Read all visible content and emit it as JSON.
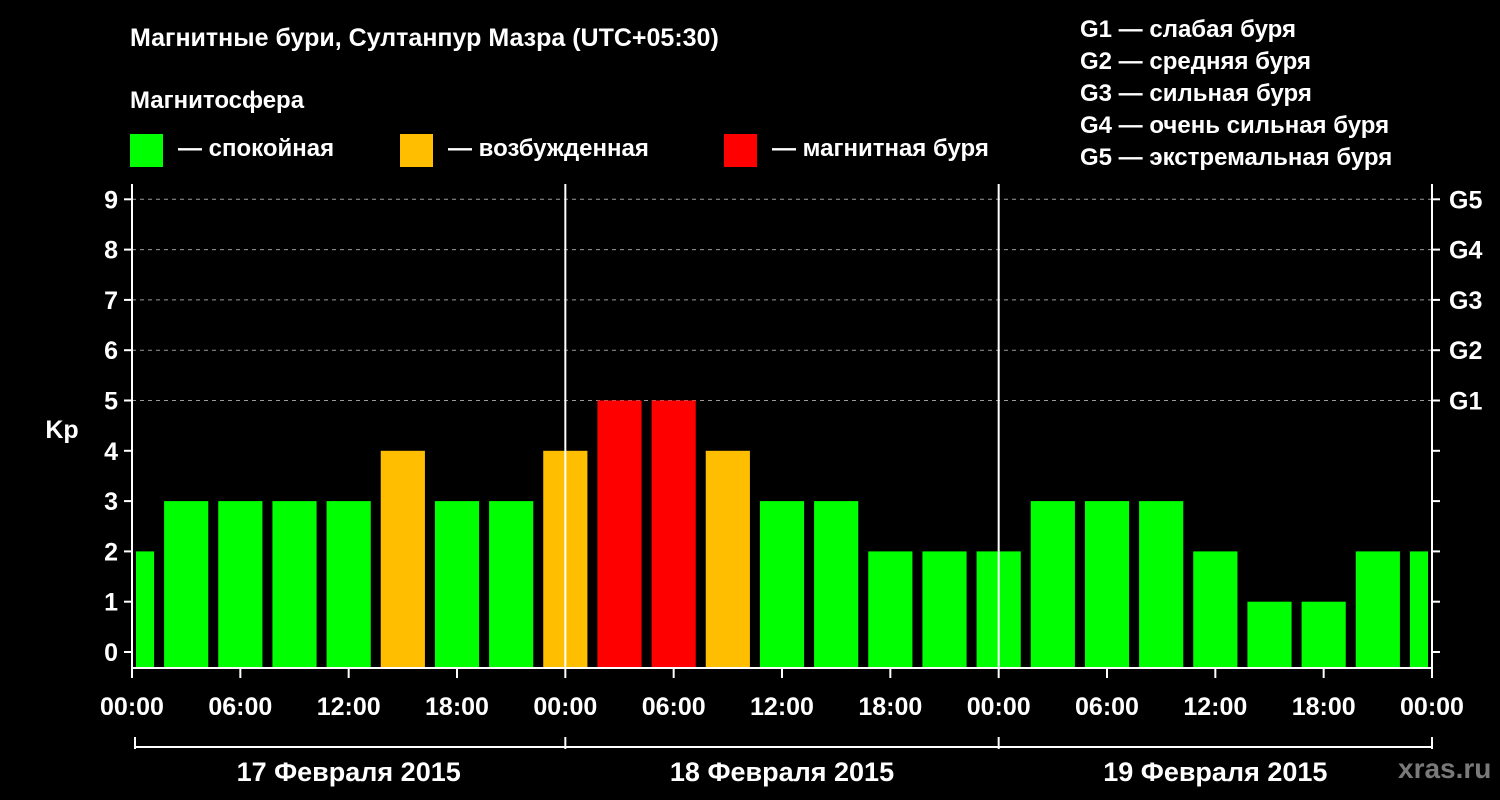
{
  "title": "Магнитные бури, Султанпур Мазра (UTC+05:30)",
  "magnetosphere_title": "Магнитосфера",
  "legend": [
    {
      "label": "— спокойная",
      "color": "#00ff00"
    },
    {
      "label": "— возбужденная",
      "color": "#ffbf00"
    },
    {
      "label": "— магнитная буря",
      "color": "#ff0000"
    }
  ],
  "g_scale": [
    "G1 — слабая буря",
    "G2 — средняя буря",
    "G3 — сильная буря",
    "G4 — очень сильная буря",
    "G5 — экстремальная буря"
  ],
  "watermark": "xras.ru",
  "chart_data": {
    "type": "bar",
    "ylabel": "Kp",
    "ylim": [
      0,
      9
    ],
    "y_ticks": [
      "0",
      "1",
      "2",
      "3",
      "4",
      "5",
      "6",
      "7",
      "8",
      "9"
    ],
    "right_ticks": [
      {
        "kp": 5,
        "label": "G1"
      },
      {
        "kp": 6,
        "label": "G2"
      },
      {
        "kp": 7,
        "label": "G3"
      },
      {
        "kp": 8,
        "label": "G4"
      },
      {
        "kp": 9,
        "label": "G5"
      }
    ],
    "x_range_hours": [
      0,
      72
    ],
    "x_tick_hours": [
      0,
      6,
      12,
      18,
      24,
      30,
      36,
      42,
      48,
      54,
      60,
      66,
      72
    ],
    "x_tick_labels": [
      "00:00",
      "06:00",
      "12:00",
      "18:00",
      "00:00",
      "06:00",
      "12:00",
      "18:00",
      "00:00",
      "06:00",
      "12:00",
      "18:00",
      "00:00"
    ],
    "days": [
      "17 Февраля 2015",
      "18 Февраля 2015",
      "19 Февраля 2015"
    ],
    "grid": "dashed horizontal lines at Kp 5–9",
    "bars": [
      {
        "start": 0,
        "end": 1.5,
        "kp": 2
      },
      {
        "start": 1.5,
        "end": 4.5,
        "kp": 3
      },
      {
        "start": 4.5,
        "end": 7.5,
        "kp": 3
      },
      {
        "start": 7.5,
        "end": 10.5,
        "kp": 3
      },
      {
        "start": 10.5,
        "end": 13.5,
        "kp": 3
      },
      {
        "start": 13.5,
        "end": 16.5,
        "kp": 4
      },
      {
        "start": 16.5,
        "end": 19.5,
        "kp": 3
      },
      {
        "start": 19.5,
        "end": 22.5,
        "kp": 3
      },
      {
        "start": 22.5,
        "end": 25.5,
        "kp": 4
      },
      {
        "start": 25.5,
        "end": 28.5,
        "kp": 5
      },
      {
        "start": 28.5,
        "end": 31.5,
        "kp": 5
      },
      {
        "start": 31.5,
        "end": 34.5,
        "kp": 4
      },
      {
        "start": 34.5,
        "end": 37.5,
        "kp": 3
      },
      {
        "start": 37.5,
        "end": 40.5,
        "kp": 3
      },
      {
        "start": 40.5,
        "end": 43.5,
        "kp": 2
      },
      {
        "start": 43.5,
        "end": 46.5,
        "kp": 2
      },
      {
        "start": 46.5,
        "end": 49.5,
        "kp": 2
      },
      {
        "start": 49.5,
        "end": 52.5,
        "kp": 3
      },
      {
        "start": 52.5,
        "end": 55.5,
        "kp": 3
      },
      {
        "start": 55.5,
        "end": 58.5,
        "kp": 3
      },
      {
        "start": 58.5,
        "end": 61.5,
        "kp": 2
      },
      {
        "start": 61.5,
        "end": 64.5,
        "kp": 1
      },
      {
        "start": 64.5,
        "end": 67.5,
        "kp": 1
      },
      {
        "start": 67.5,
        "end": 70.5,
        "kp": 2
      },
      {
        "start": 70.5,
        "end": 72,
        "kp": 2
      }
    ],
    "colors": {
      "calm": "#00ff00",
      "active": "#ffbf00",
      "storm": "#ff0000"
    }
  }
}
